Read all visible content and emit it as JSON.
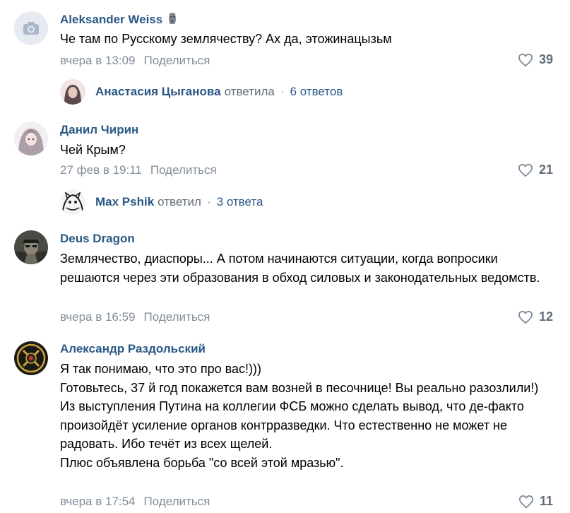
{
  "comments": [
    {
      "author": "Aleksander Weiss",
      "badge_icon": "moai-icon",
      "text": [
        "Че там по Русскому землячеству? Ах да, этожинацызьм"
      ],
      "time": "вчера в 13:09",
      "share": "Поделиться",
      "likes": "39",
      "reply": {
        "name": "Анастасия Цыганова",
        "verb": "ответила",
        "count": "6 ответов"
      }
    },
    {
      "author": "Данил Чирин",
      "text": [
        "Чей Крым?"
      ],
      "time": "27 фев в 19:11",
      "share": "Поделиться",
      "likes": "21",
      "reply": {
        "name": "Max Pshik",
        "verb": "ответил",
        "count": "3 ответа"
      }
    },
    {
      "author": "Deus Dragon",
      "text": [
        "Землячество, диаспоры... А потом начинаются ситуации, когда вопросики решаются через эти образования в обход силовых и законодательных ведомств."
      ],
      "time": "вчера в 16:59",
      "share": "Поделиться",
      "likes": "12"
    },
    {
      "author": "Александр Раздольский",
      "text": [
        "Я так понимаю, что это про вас!)))",
        "Готовьтесь, 37 й год покажется вам возней в песочнице! Вы реально разозлили!)",
        "Из выступления Путина на коллегии ФСБ можно сделать вывод, что де-факто произойдёт усиление органов контрразведки. Что естественно не может не радовать. Ибо течёт из всех щелей.",
        "Плюс объявлена борьба \"со всей этой мразью\"."
      ],
      "time": "вчера в 17:54",
      "share": "Поделиться",
      "likes": "11"
    }
  ],
  "colors": {
    "link": "#2a5885",
    "meta": "#818c99",
    "like_count": "#626d7a"
  }
}
